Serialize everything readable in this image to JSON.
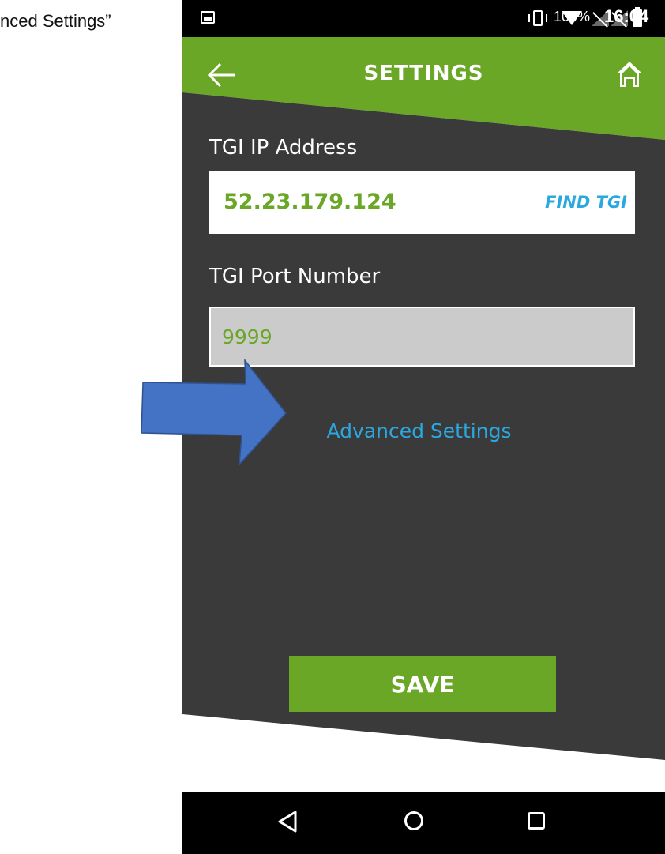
{
  "caption": "nced Settings”",
  "status_bar": {
    "battery_percent": "100%",
    "time": "16:04"
  },
  "header": {
    "title": "SETTINGS",
    "back_icon": "arrow-left-icon",
    "home_icon": "home-icon"
  },
  "form": {
    "ip_label": "TGI IP Address",
    "ip_value": "52.23.179.124",
    "find_tgi_label": "FIND TGI",
    "port_label": "TGI Port Number",
    "port_value": "9999",
    "advanced_link": "Advanced Settings",
    "save_label": "SAVE"
  },
  "nav_bar": {
    "back": "triangle-back-icon",
    "home": "circle-home-icon",
    "recents": "square-recents-icon"
  },
  "colors": {
    "accent_green": "#6aa726",
    "link_blue": "#2aa8df",
    "panel_dark": "#3a3a3a",
    "annotation_arrow": "#4472c4"
  }
}
